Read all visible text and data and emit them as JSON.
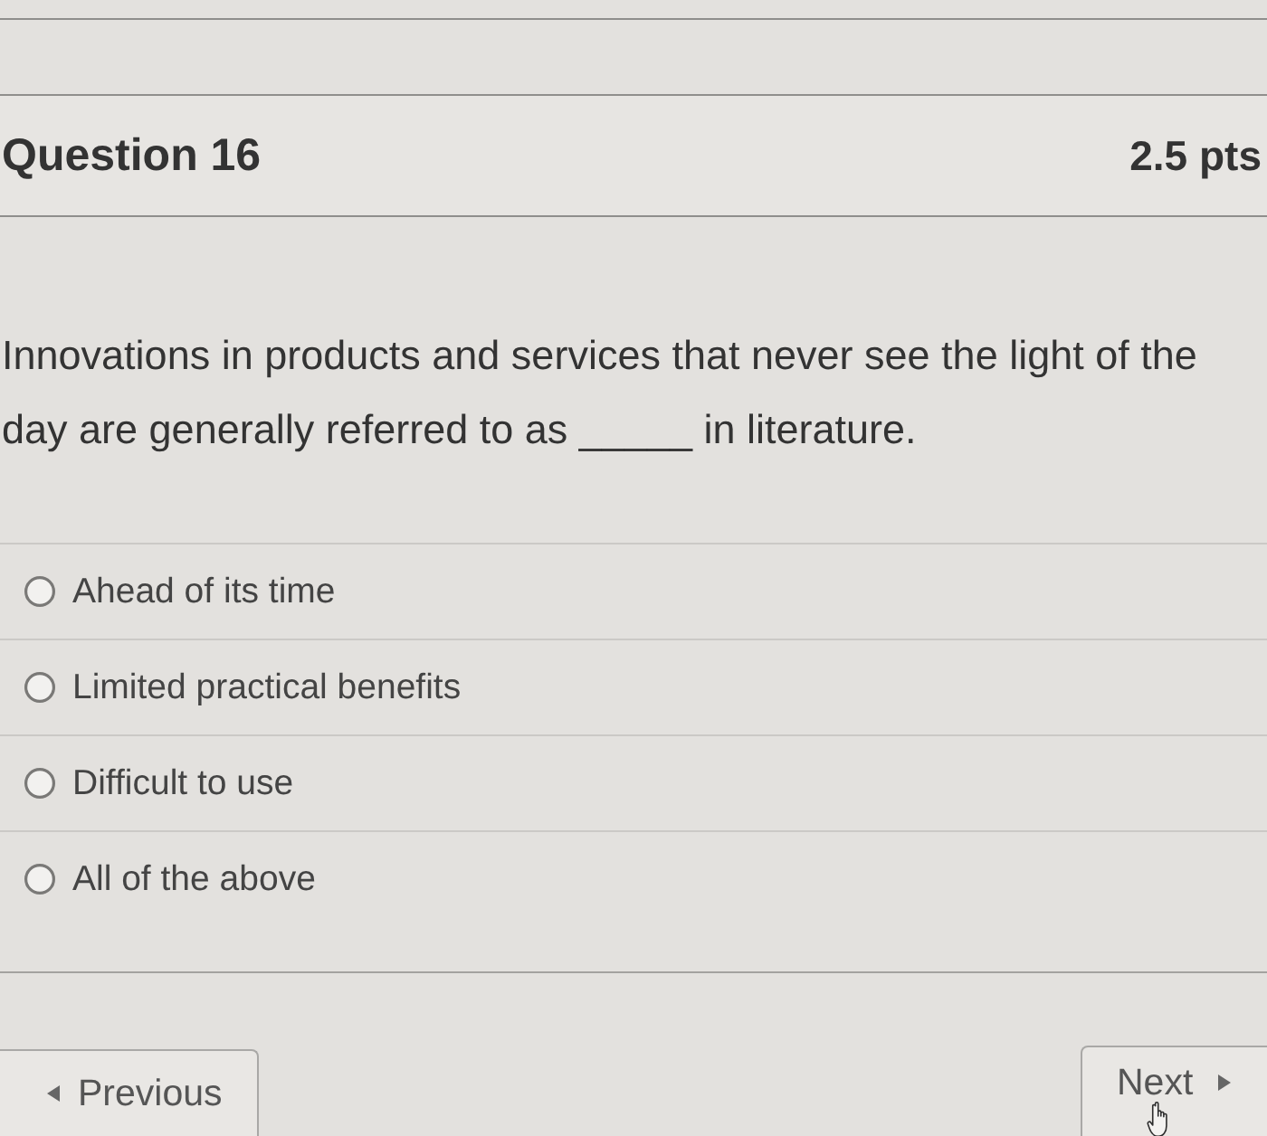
{
  "header": {
    "title": "Question 16",
    "points": "2.5 pts"
  },
  "question": {
    "text": "Innovations in products and services that never see the light of the day are generally referred to as _____ in literature."
  },
  "options": [
    {
      "label": "Ahead of its time",
      "selected": false
    },
    {
      "label": "Limited practical benefits",
      "selected": false
    },
    {
      "label": "Difficult to use",
      "selected": false
    },
    {
      "label": "All of the above",
      "selected": false
    }
  ],
  "nav": {
    "previous": "Previous",
    "next": "Next"
  }
}
